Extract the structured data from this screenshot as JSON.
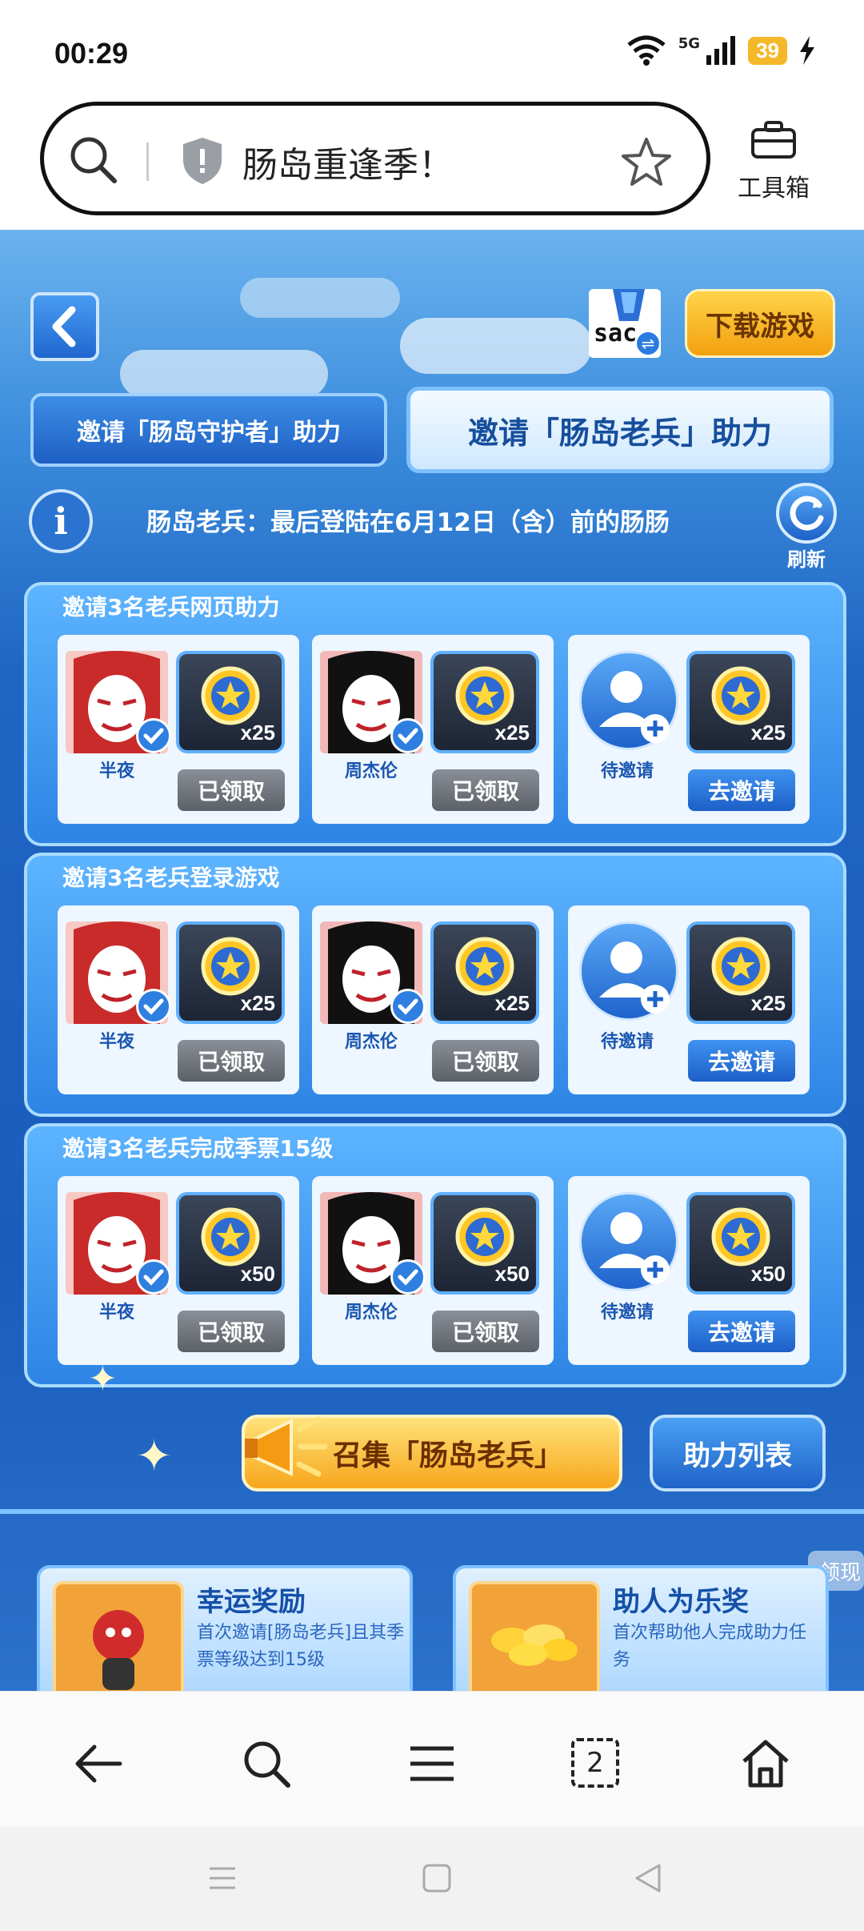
{
  "status_bar": {
    "time": "00:29",
    "network": "5G",
    "battery": "39"
  },
  "browser": {
    "page_title": "肠岛重逢季！",
    "toolbox_label": "工具箱",
    "tab_count": "2"
  },
  "header": {
    "download_label": "下载游戏",
    "user_avatar_text": "sac"
  },
  "tabs": [
    {
      "label": "邀请「肠岛守护者」助力",
      "active": false
    },
    {
      "label": "邀请「肠岛老兵」助力",
      "active": true
    }
  ],
  "notice": "肠岛老兵：最后登陆在6月12日（含）前的肠肠",
  "refresh_label": "刷新",
  "sections": [
    {
      "title": "邀请3名老兵网页助力",
      "slots": [
        {
          "name": "半夜",
          "count": "x25",
          "button": "已领取",
          "status": "claimed"
        },
        {
          "name": "周杰伦",
          "count": "x25",
          "button": "已领取",
          "status": "claimed"
        },
        {
          "name": "待邀请",
          "count": "x25",
          "button": "去邀请",
          "status": "invite"
        }
      ]
    },
    {
      "title": "邀请3名老兵登录游戏",
      "slots": [
        {
          "name": "半夜",
          "count": "x25",
          "button": "已领取",
          "status": "claimed"
        },
        {
          "name": "周杰伦",
          "count": "x25",
          "button": "已领取",
          "status": "claimed"
        },
        {
          "name": "待邀请",
          "count": "x25",
          "button": "去邀请",
          "status": "invite"
        }
      ]
    },
    {
      "title": "邀请3名老兵完成季票15级",
      "slots": [
        {
          "name": "半夜",
          "count": "x50",
          "button": "已领取",
          "status": "claimed"
        },
        {
          "name": "周杰伦",
          "count": "x50",
          "button": "已领取",
          "status": "claimed"
        },
        {
          "name": "待邀请",
          "count": "x50",
          "button": "去邀请",
          "status": "invite"
        }
      ]
    }
  ],
  "rally_label": "召集「肠岛老兵」",
  "help_list_label": "助力列表",
  "float_label": "领现",
  "bottom_cards": [
    {
      "title": "幸运奖励",
      "desc": "首次邀请[肠岛老兵]且其季票等级达到15级"
    },
    {
      "title": "助人为乐奖",
      "desc": "首次帮助他人完成助力任务"
    }
  ],
  "colors": {
    "accent_blue": "#1f66c4",
    "gold": "#f7a61c",
    "claimed_gray": "#6e737a"
  }
}
